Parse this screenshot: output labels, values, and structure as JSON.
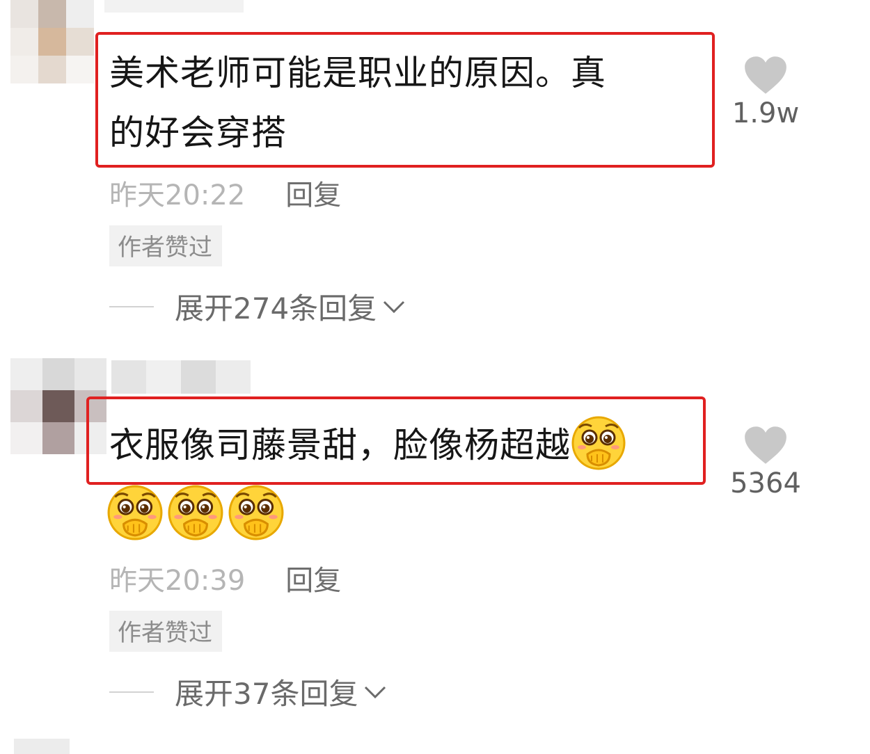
{
  "comments": [
    {
      "text_line1": "美术老师可能是职业的原因。真",
      "text_line2": "的好会穿搭",
      "time": "昨天20:22",
      "reply": "回复",
      "badge": "作者赞过",
      "expand": "展开274条回复",
      "likes": "1.9w"
    },
    {
      "text_line1": "衣服像司藤景甜，脸像杨超越",
      "emoji": "pleading-hand-over-mouth-emoji",
      "trailing_emoji_count": 3,
      "time": "昨天20:39",
      "reply": "回复",
      "badge": "作者赞过",
      "expand": "展开37条回复",
      "likes": "5364"
    }
  ],
  "colors": {
    "highlight": "#e02020",
    "heart": "#c8c8c8",
    "badge_bg": "#f1f1f1",
    "muted_text": "#b5b5b5"
  },
  "icons": {
    "like": "heart-icon",
    "expand": "chevron-down-icon"
  }
}
